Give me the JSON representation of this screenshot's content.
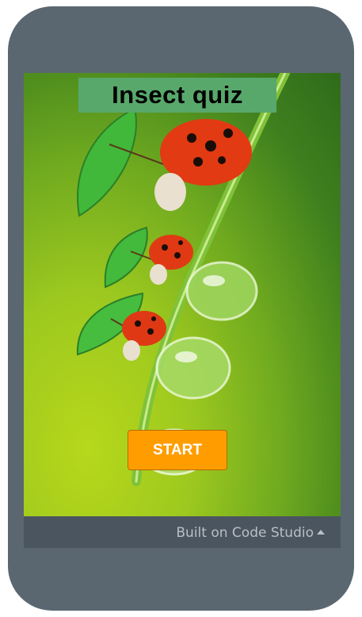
{
  "app": {
    "title": "Insect quiz",
    "start_label": "START",
    "footer_label": "Built on Code Studio"
  },
  "colors": {
    "device_frame": "#5b6770",
    "title_background": "#58a86b",
    "start_button": "#ff9d00",
    "footer_bar": "#4b5560"
  },
  "icons": {
    "footer_caret": "caret-up-icon"
  }
}
